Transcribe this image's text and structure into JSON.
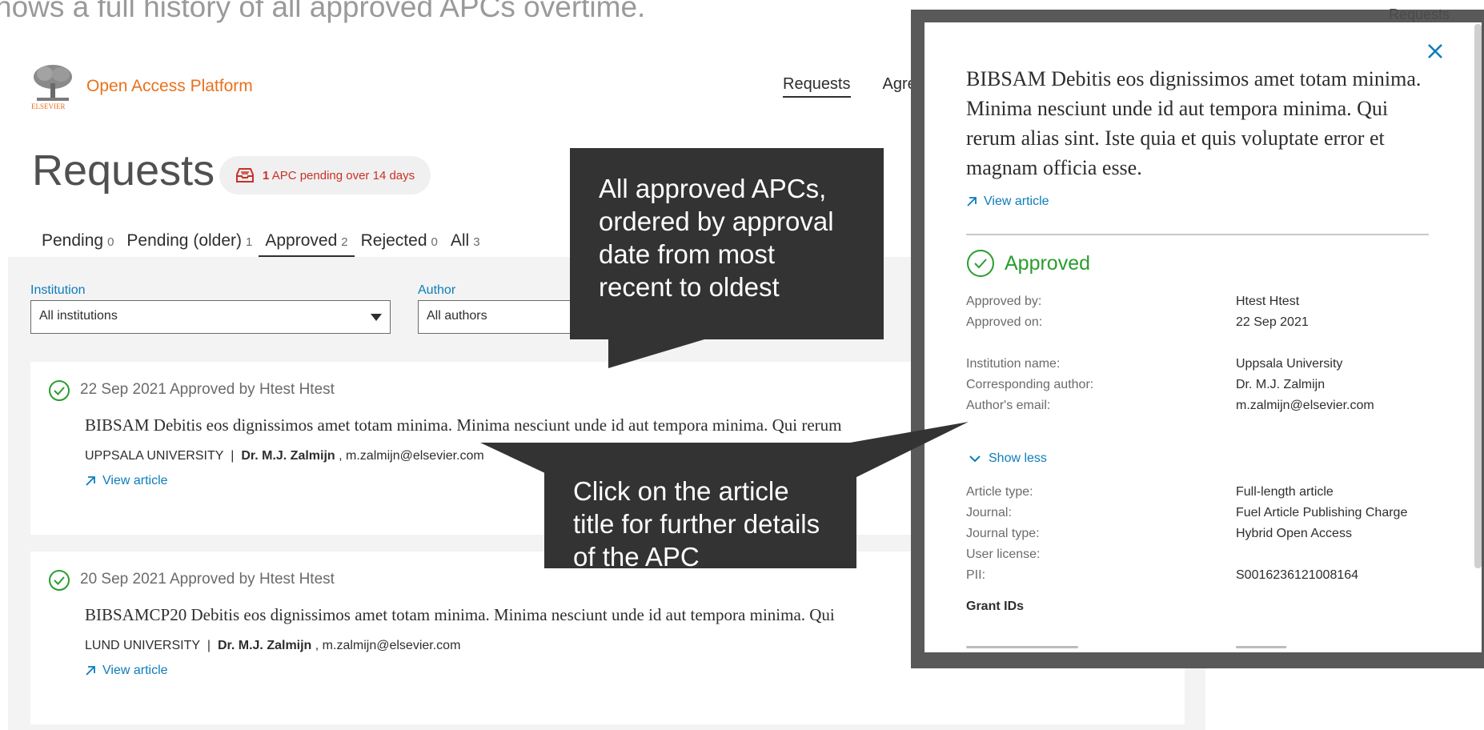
{
  "caption": "hows a full history of all approved APCs overtime.",
  "header": {
    "logo_text": "ELSEVIER",
    "platform_name": "Open Access Platform",
    "nav": [
      "Requests",
      "Agre"
    ]
  },
  "page": {
    "title": "Requests",
    "pending_badge": {
      "count": "1",
      "text": "APC pending over 14 days"
    }
  },
  "tabs": [
    {
      "label": "Pending",
      "count": "0"
    },
    {
      "label": "Pending (older)",
      "count": "1"
    },
    {
      "label": "Approved",
      "count": "2",
      "active": true
    },
    {
      "label": "Rejected",
      "count": "0"
    },
    {
      "label": "All",
      "count": "3"
    }
  ],
  "filters": {
    "institution": {
      "label": "Institution",
      "value": "All institutions"
    },
    "author": {
      "label": "Author",
      "value": "All authors"
    }
  },
  "cards": [
    {
      "meta": "22 Sep 2021 Approved by Htest Htest",
      "title": "BIBSAM Debitis eos dignissimos amet totam minima. Minima nesciunt unde id aut tempora minima. Qui rerum",
      "institution": "UPPSALA UNIVERSITY",
      "author": "Dr. M.J. Zalmijn",
      "email": "m.zalmijn@elsevier.com",
      "view": "View article"
    },
    {
      "meta": "20 Sep 2021 Approved by Htest Htest",
      "title": "BIBSAMCP20 Debitis eos dignissimos amet totam minima. Minima nesciunt unde id aut tempora minima. Qui",
      "institution": "LUND UNIVERSITY",
      "author": "Dr. M.J. Zalmijn",
      "email": "m.zalmijn@elsevier.com",
      "view": "View article"
    }
  ],
  "panel": {
    "header_label": "Requests",
    "title": "BIBSAM Debitis eos dignissimos amet totam minima. Minima nesciunt unde id aut tempora minima. Qui rerum alias sint. Iste quia et quis voluptate error et magnam officia esse.",
    "view_article": "View article",
    "status": "Approved",
    "approved_by_label": "Approved by:",
    "approved_by": "Htest Htest",
    "approved_on_label": "Approved on:",
    "approved_on": "22 Sep 2021",
    "institution_label": "Institution name:",
    "institution": "Uppsala University",
    "corr_author_label": "Corresponding author:",
    "corr_author": "Dr. M.J. Zalmijn",
    "email_label": "Author's email:",
    "email": "m.zalmijn@elsevier.com",
    "show_less": "Show less",
    "article_type_label": "Article type:",
    "article_type": "Full-length article",
    "journal_label": "Journal:",
    "journal": "Fuel Article Publishing Charge",
    "journal_type_label": "Journal type:",
    "journal_type": "Hybrid Open Access",
    "license_label": "User license:",
    "pii_label": "PII:",
    "pii": "S0016236121008164",
    "grant_ids": "Grant IDs"
  },
  "callouts": {
    "list": "All approved APCs, ordered by approval date from most recent to oldest",
    "details": "Click on the article title for further details of the APC"
  },
  "colors": {
    "brand_orange": "#e9711c",
    "link_blue": "#0c7dbb",
    "approved_green": "#2a9d2f",
    "pending_red": "#c83127",
    "callout_bg": "#333333"
  }
}
